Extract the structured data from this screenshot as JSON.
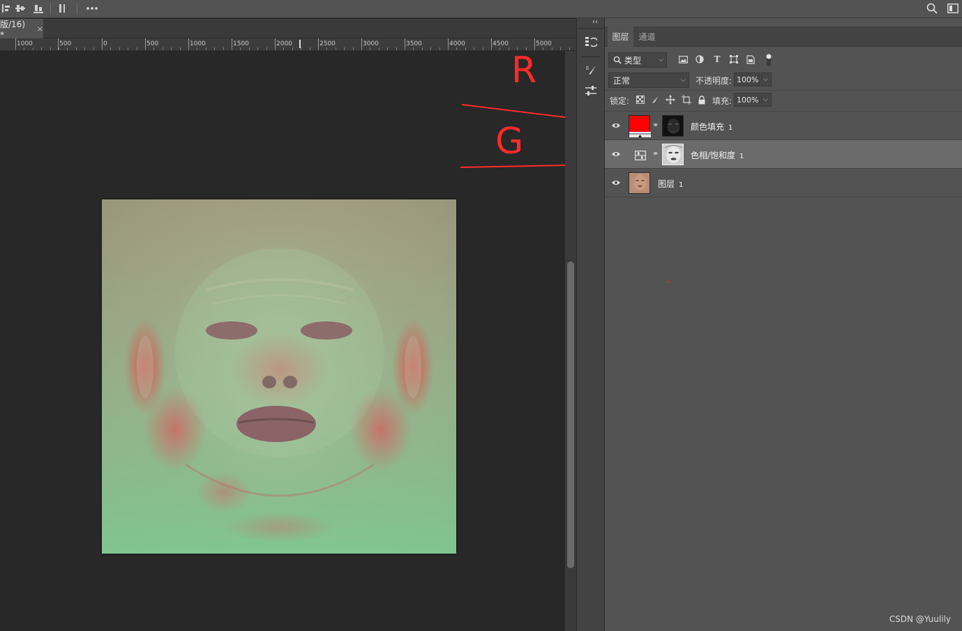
{
  "topbar": {
    "icons": [
      "align-left-icon",
      "align-center-icon",
      "align-bottom-icon",
      "distribute-icon",
      "more-icon",
      "search-icon",
      "workspace-icon"
    ]
  },
  "document": {
    "tab_title": "版/16) *",
    "close_glyph": "×"
  },
  "ruler": {
    "labels": [
      "1000",
      "500",
      "0",
      "500",
      "1000",
      "1500",
      "2000",
      "2500",
      "3000",
      "3500",
      "4000",
      "4500",
      "5000"
    ]
  },
  "annotations": {
    "r_label": "R",
    "g_label": "G",
    "color": "#ff2a2a"
  },
  "panel": {
    "collapse_glyph": "‹‹",
    "tabs": [
      {
        "label": "图层",
        "active": true
      },
      {
        "label": "通道",
        "active": false
      }
    ],
    "filter": {
      "value": "类型"
    },
    "blend_mode": {
      "value": "正常"
    },
    "opacity": {
      "label": "不透明度:",
      "value": "100%"
    },
    "lock": {
      "label": "锁定:"
    },
    "fill": {
      "label": "填充:",
      "value": "100%"
    },
    "layers": [
      {
        "name": "颜色填充",
        "number": "1",
        "visible": true,
        "selected": false,
        "type": "fill"
      },
      {
        "name": "色相/饱和度",
        "number": "1",
        "visible": true,
        "selected": true,
        "type": "adjustment"
      },
      {
        "name": "图层",
        "number": "1",
        "visible": true,
        "selected": false,
        "type": "pixel"
      }
    ]
  },
  "colors": {
    "fill_swatch": "#ff0000",
    "ui_dark": "#282828",
    "panel_bg": "#535353"
  },
  "watermark": "CSDN @Yuulily"
}
